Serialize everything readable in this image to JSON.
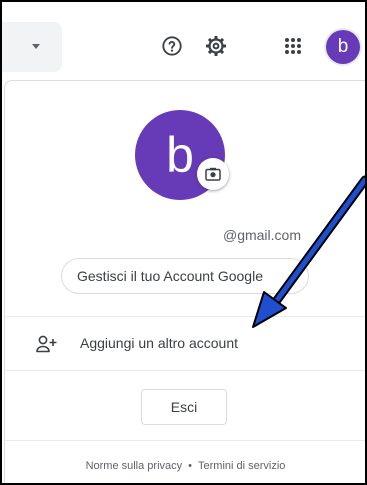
{
  "header": {
    "help_icon": "help-icon",
    "settings_icon": "settings-gear-icon",
    "apps_icon": "apps-grid-icon",
    "avatar_letter": "b"
  },
  "account": {
    "avatar_letter": "b",
    "avatar_color": "#673ab7",
    "email": "@gmail.com",
    "manage_label": "Gestisci il tuo Account Google",
    "add_account_label": "Aggiungi un altro account",
    "sign_out_label": "Esci"
  },
  "footer": {
    "privacy": "Norme sulla privacy",
    "separator": "•",
    "terms": "Termini di servizio"
  },
  "annotation": {
    "arrow_color": "#1f4fd1"
  }
}
